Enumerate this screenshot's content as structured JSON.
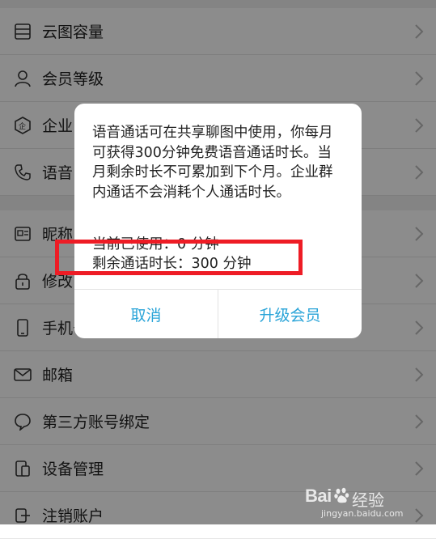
{
  "settings": {
    "rows": [
      {
        "label": "云图容量",
        "icon": "storage-icon"
      },
      {
        "label": "会员等级",
        "icon": "person-icon"
      },
      {
        "label": "企业",
        "icon": "enterprise-icon"
      },
      {
        "label": "语音",
        "icon": "phone-icon"
      },
      {
        "label": "昵称",
        "icon": "id-card-icon"
      },
      {
        "label": "修改",
        "icon": "lock-icon"
      },
      {
        "label": "手机号",
        "icon": "mobile-icon"
      },
      {
        "label": "邮箱",
        "icon": "mail-icon"
      },
      {
        "label": "第三方账号绑定",
        "icon": "chat-bubble-icon"
      },
      {
        "label": "设备管理",
        "icon": "device-icon"
      },
      {
        "label": "注销账户",
        "icon": "logout-icon"
      }
    ]
  },
  "dialog": {
    "message": "语音通话可在共享聊图中使用，你每月可获得300分钟免费语音通话时长。当月剩余时长不可累加到下个月。企业群内通话不会消耗个人通话时长。",
    "used": "当前已使用：0 分钟",
    "remaining": "剩余通话时长：300 分钟",
    "cancel_label": "取消",
    "upgrade_label": "升级会员"
  },
  "watermark": {
    "brand": "Bai",
    "brand_suffix": "经验",
    "url": "jingyan.baidu.com"
  },
  "colors": {
    "accent": "#2aa4d8",
    "highlight": "#ee1c25"
  }
}
